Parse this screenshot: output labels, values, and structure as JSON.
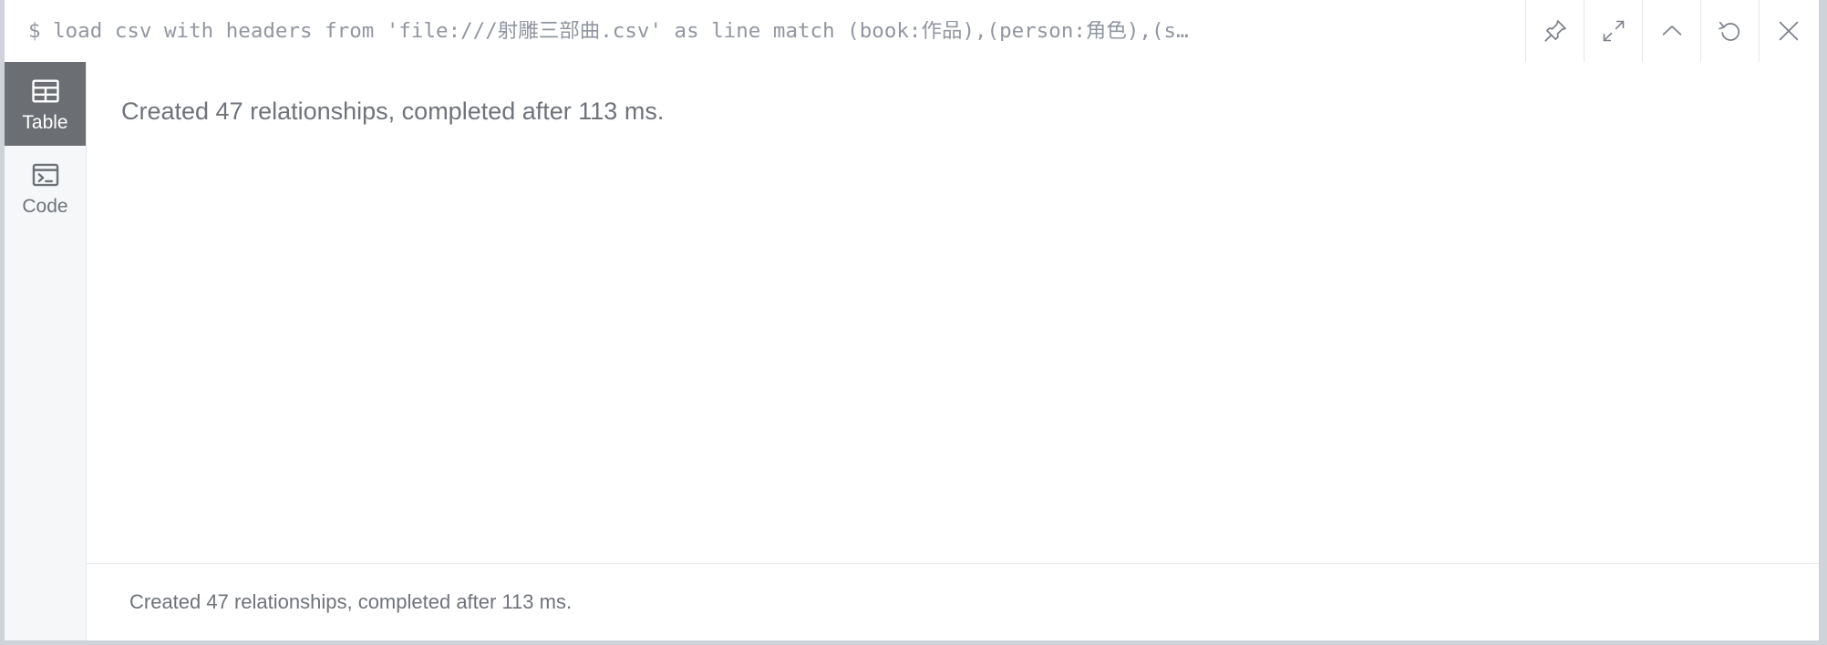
{
  "editor": {
    "prompt": "$",
    "command": "load csv with headers from 'file:///射雕三部曲.csv' as line  match (book:作品),(person:角色),(s…",
    "full_command_visible": "$ load csv with headers from 'file:///射雕三部曲.csv' as line  match (book:作品),(person:角色),(s…"
  },
  "toolbar": {
    "buttons": [
      {
        "name": "pin-icon",
        "label": "Pin"
      },
      {
        "name": "expand-icon",
        "label": "Expand"
      },
      {
        "name": "collapse-icon",
        "label": "Collapse"
      },
      {
        "name": "refresh-icon",
        "label": "Refresh"
      },
      {
        "name": "close-icon",
        "label": "Close"
      }
    ]
  },
  "sidebar": {
    "items": [
      {
        "label": "Table",
        "icon": "table-icon",
        "active": true
      },
      {
        "label": "Code",
        "icon": "code-icon",
        "active": false
      }
    ]
  },
  "result": {
    "message": "Created 47 relationships, completed after 113 ms."
  },
  "status": {
    "message": "Created 47 relationships, completed after 113 ms."
  },
  "colors": {
    "frame_border": "#ced2d9",
    "divider": "#e4e6ea",
    "sidebar_bg": "#f6f7f9",
    "active_tab_bg": "#6b6e72",
    "text_muted": "#6f737a",
    "command_text": "#9196a0"
  }
}
